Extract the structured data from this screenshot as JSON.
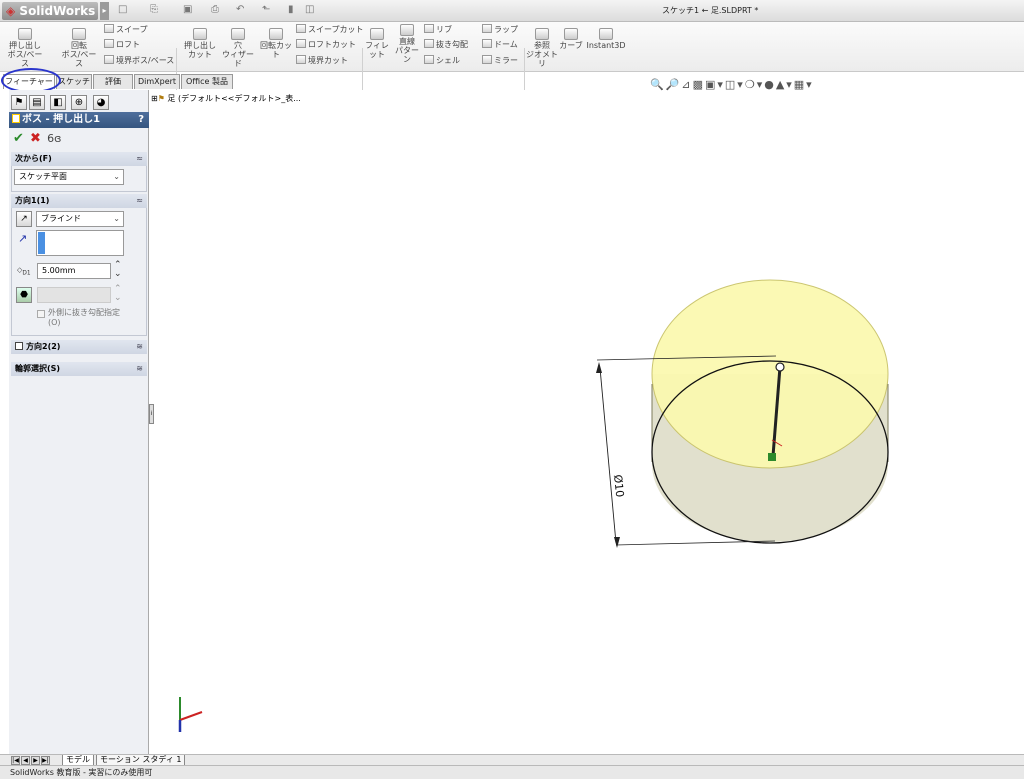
{
  "app": {
    "name": "SolidWorks",
    "doc_title": "スケッチ1 ← 足.SLDPRT *"
  },
  "quick_access": [
    "□",
    "⎘",
    "▣",
    "⎙",
    "↶",
    "⬑",
    "▮",
    "◫"
  ],
  "ribbon": {
    "extrude_boss": "押し出し\nボス/ベース",
    "revolve_boss": "回転\nボス/ベース",
    "sweep": "スイープ",
    "loft": "ロフト",
    "boundary_boss": "境界ボス/ベース",
    "extrude_cut": "押し出し\nカット",
    "hole_wizard": "穴\nウィザード",
    "revolve_cut": "回転カット",
    "swept_cut": "スイープカット",
    "lofted_cut": "ロフトカット",
    "boundary_cut": "境界カット",
    "fillet": "フィレット",
    "linear_pattern": "直線\nパターン",
    "rib": "リブ",
    "draft": "抜き勾配",
    "shell": "シェル",
    "wrap": "ラップ",
    "dome": "ドーム",
    "mirror": "ミラー",
    "ref_geometry": "参照\nジオメトリ",
    "curves": "カーブ",
    "instant3d": "Instant3D"
  },
  "tabs": [
    "フィーチャー",
    "スケッチ",
    "評価",
    "DimXpert",
    "Office 製品"
  ],
  "tree": {
    "root": "足 (デフォルト<<デフォルト>_表..."
  },
  "panel": {
    "title": "ボス - 押し出し1",
    "help": "?",
    "from_header": "次から(F)",
    "from_value": "スケッチ平面",
    "dir1_header": "方向1(1)",
    "end_condition": "ブラインド",
    "depth_value": "5.00mm",
    "depth_label": "D1",
    "draft_outward": "外側に抜き勾配指定(O)",
    "dir2_header": "方向2(2)",
    "contour_header": "輪郭選択(S)"
  },
  "dimension": {
    "label": "Ø10"
  },
  "bottom_tabs": [
    "モデル",
    "モーション スタディ 1"
  ],
  "status": "SolidWorks 教育版 - 実習にのみ使用可",
  "colors": {
    "accent": "#2a35cc",
    "header": "#35557f",
    "preview_fill": "#fbf9b0"
  }
}
